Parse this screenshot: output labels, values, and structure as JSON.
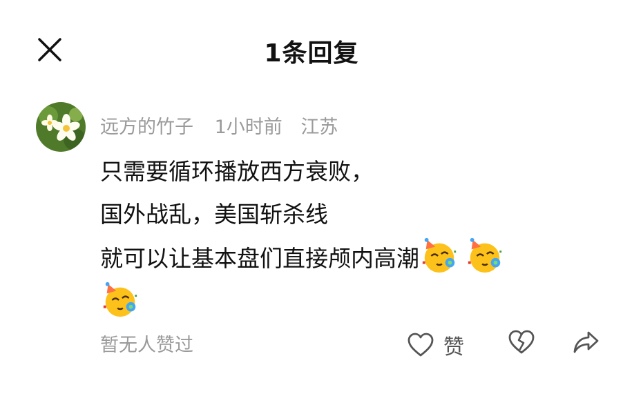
{
  "header": {
    "title": "1条回复"
  },
  "comment": {
    "username": "远方的竹子",
    "time": "1小时前",
    "location": "江苏",
    "lines": [
      "只需要循环播放西方衰败，",
      "国外战乱，美国斩杀线",
      "就可以让基本盘们直接颅内高潮"
    ],
    "emoji_name": "partying-face-icon"
  },
  "footer": {
    "no_likes_text": "暂无人赞过",
    "like_label": "赞"
  },
  "colors": {
    "text_primary": "#111111",
    "text_secondary": "#9a9a9a",
    "icon": "#555555"
  }
}
